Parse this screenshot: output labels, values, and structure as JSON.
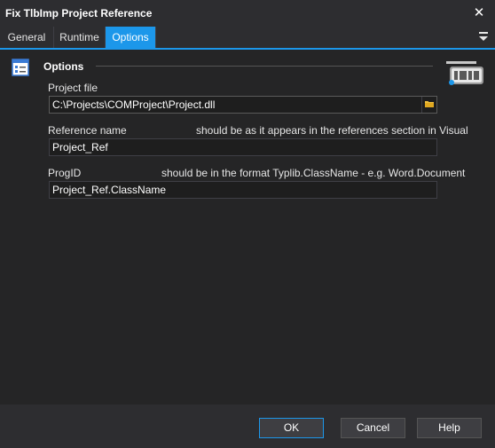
{
  "window": {
    "title": "Fix TlbImp Project Reference",
    "close_glyph": "✕"
  },
  "tabs": [
    {
      "label": "General",
      "active": false
    },
    {
      "label": "Runtime",
      "active": false
    },
    {
      "label": "Options",
      "active": true
    }
  ],
  "section": {
    "title": "Options",
    "icon": "options-icon",
    "logo": "dotnet-logo"
  },
  "fields": {
    "project_file": {
      "label": "Project file",
      "value": "C:\\Projects\\COMProject\\Project.dll"
    },
    "reference_name": {
      "label": "Reference name",
      "hint": "should be as it appears in the references section in Visual",
      "value": "Project_Ref"
    },
    "progid": {
      "label": "ProgID",
      "hint": "should be in the format Typlib.ClassName - e.g. Word.Document",
      "value": "Project_Ref.ClassName"
    }
  },
  "buttons": {
    "ok": "OK",
    "cancel": "Cancel",
    "help": "Help"
  },
  "colors": {
    "accent": "#1c97ea",
    "background": "#252526",
    "chrome": "#2d2d30"
  }
}
